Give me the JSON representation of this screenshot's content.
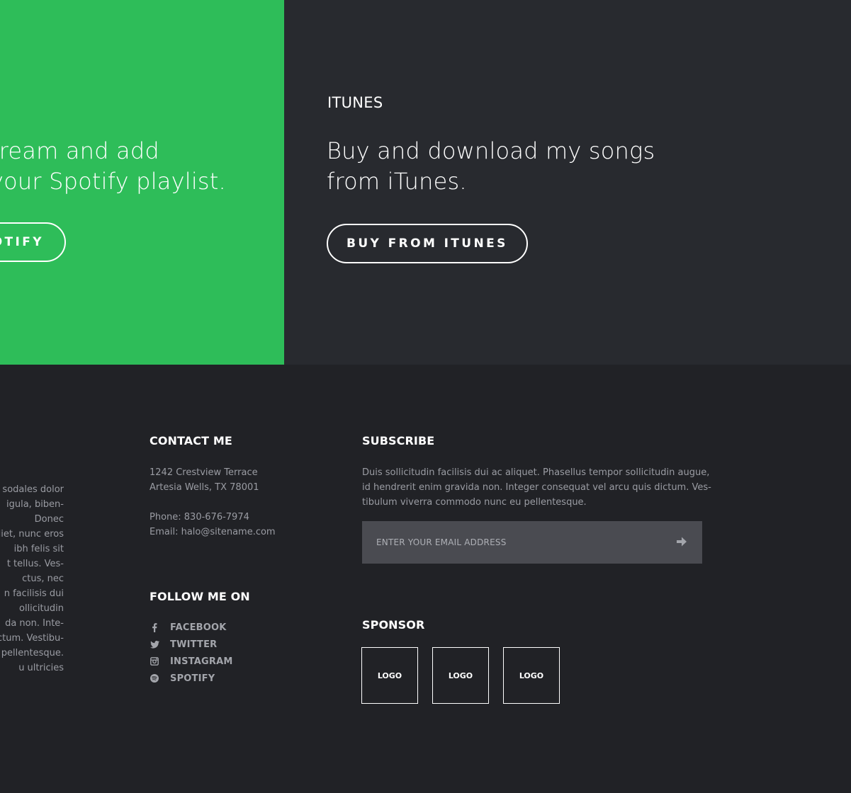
{
  "spotify": {
    "lines": [
      "tream and add",
      "your Spotify playlist."
    ],
    "button_label": "OTIFY",
    "bg_color": "#2ebd59"
  },
  "itunes": {
    "heading": "ITUNES",
    "lines": [
      "Buy and download my songs",
      "from iTunes."
    ],
    "button_label": "BUY FROM ITUNES",
    "bg_color": "#282a2f"
  },
  "about": {
    "lines": [
      "sodales dolor",
      "igula, biben-",
      "Donec",
      "diet, nunc eros",
      "ibh felis sit",
      "t tellus. Ves-",
      "ctus, nec",
      "n facilisis dui",
      "ollicitudin",
      "da non. Inte-",
      "ctum. Vestibu-",
      "pellentesque.",
      "u ultricies"
    ]
  },
  "contact": {
    "heading": "CONTACT ME",
    "address_line1": "1242 Crestview Terrace",
    "address_line2": "Artesia Wells, TX 78001",
    "phone": "Phone: 830-676-7974",
    "email": "Email: halo@sitename.com"
  },
  "follow": {
    "heading": "FOLLOW ME ON",
    "items": [
      {
        "label": "FACEBOOK",
        "icon": "facebook-icon"
      },
      {
        "label": "TWITTER",
        "icon": "twitter-icon"
      },
      {
        "label": "INSTAGRAM",
        "icon": "instagram-icon"
      },
      {
        "label": "SPOTIFY",
        "icon": "spotify-icon"
      }
    ]
  },
  "subscribe": {
    "heading": "SUBSCRIBE",
    "description_lines": [
      "Duis sollicitudin facilisis dui ac aliquet. Phasellus tempor sollicitudin augue,",
      "id hendrerit enim gravida non. Integer consequat vel arcu quis dictum. Ves-",
      "tibulum viverra commodo nunc eu pellentesque."
    ],
    "email_placeholder": "ENTER YOUR EMAIL ADDRESS",
    "email_value": "",
    "submit_icon": "arrow-right-icon"
  },
  "sponsor": {
    "heading": "SPONSOR",
    "logos": [
      "LOGO",
      "LOGO",
      "LOGO"
    ]
  }
}
